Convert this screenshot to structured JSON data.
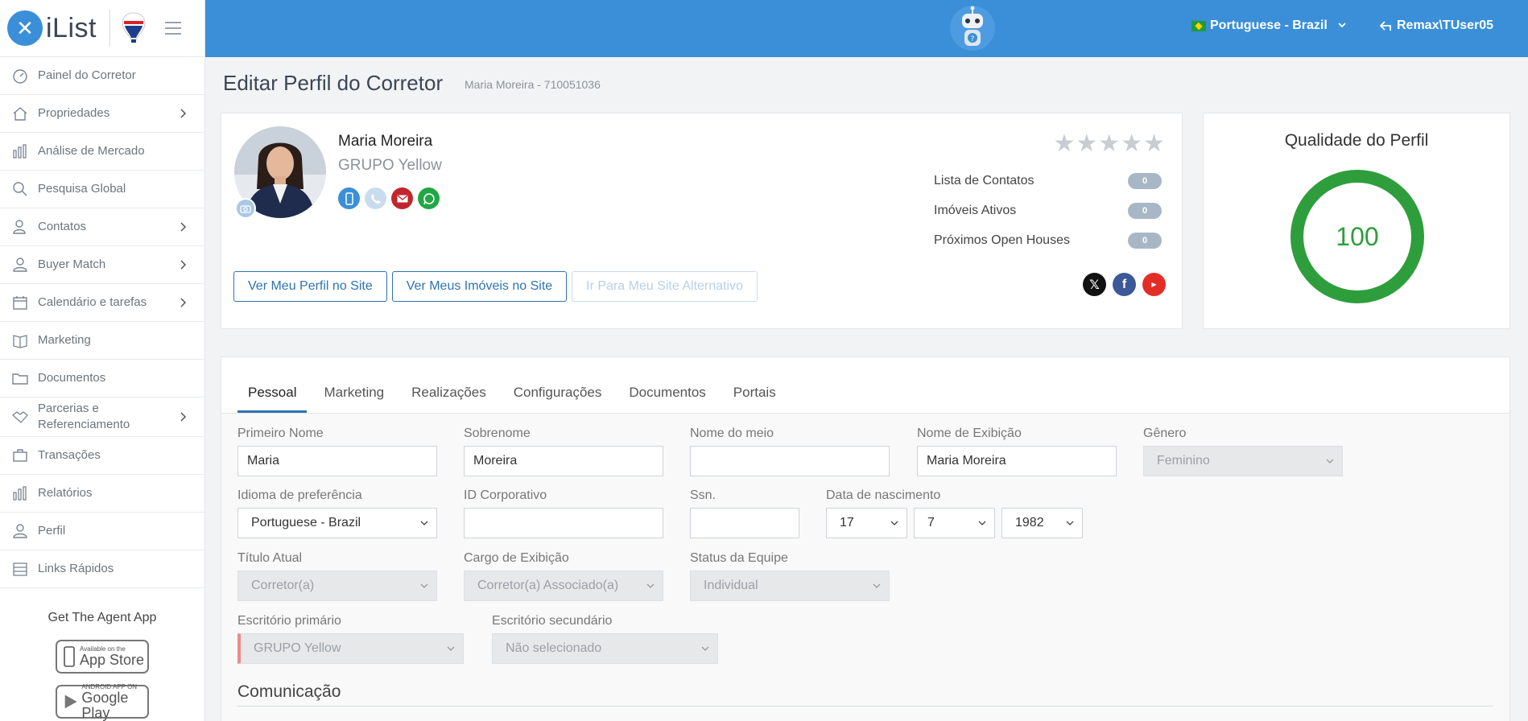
{
  "app": {
    "logo_text": "iList",
    "language": "Portuguese - Brazil",
    "user": "Remax\\TUser05"
  },
  "sidebar": {
    "items": [
      {
        "label": "Painel do Corretor",
        "icon": "dashboard-icon",
        "has_submenu": false
      },
      {
        "label": "Propriedades",
        "icon": "home-icon",
        "has_submenu": true
      },
      {
        "label": "Análise de Mercado",
        "icon": "bar-chart-icon",
        "has_submenu": false
      },
      {
        "label": "Pesquisa Global",
        "icon": "search-icon",
        "has_submenu": false
      },
      {
        "label": "Contatos",
        "icon": "contacts-icon",
        "has_submenu": true
      },
      {
        "label": "Buyer Match",
        "icon": "user-icon",
        "has_submenu": true
      },
      {
        "label": "Calendário e tarefas",
        "icon": "calendar-icon",
        "has_submenu": true
      },
      {
        "label": "Marketing",
        "icon": "book-icon",
        "has_submenu": false
      },
      {
        "label": "Documentos",
        "icon": "folder-icon",
        "has_submenu": false
      },
      {
        "label": "Parcerias e Referenciamento",
        "icon": "handshake-icon",
        "has_submenu": true
      },
      {
        "label": "Transações",
        "icon": "briefcase-icon",
        "has_submenu": false
      },
      {
        "label": "Relatórios",
        "icon": "report-icon",
        "has_submenu": false
      },
      {
        "label": "Perfil",
        "icon": "profile-icon",
        "has_submenu": false
      },
      {
        "label": "Links Rápidos",
        "icon": "links-icon",
        "has_submenu": false
      }
    ],
    "app_title": "Get The Agent App",
    "app_store": {
      "small": "Available on the",
      "big": "App Store"
    },
    "google_play": {
      "small": "ANDROID APP ON",
      "big": "Google Play"
    }
  },
  "page": {
    "title": "Editar Perfil do Corretor",
    "subtitle": "Maria Moreira - 710051036"
  },
  "profile": {
    "name": "Maria Moreira",
    "group": "GRUPO Yellow",
    "rating": 0,
    "stats": [
      {
        "label": "Lista de Contatos",
        "value": "0"
      },
      {
        "label": "Imóveis Ativos",
        "value": "0"
      },
      {
        "label": "Próximos Open Houses",
        "value": "0"
      }
    ],
    "buttons": {
      "view_profile": "Ver Meu Perfil no Site",
      "view_listings": "Ver Meus Imóveis no Site",
      "alt_site": "Ir Para Meu Site Alternativo"
    }
  },
  "quality": {
    "title": "Qualidade do Perfil",
    "score": "100",
    "percent": 100,
    "color": "#2e9e3c"
  },
  "tabs": [
    "Pessoal",
    "Marketing",
    "Realizações",
    "Configurações",
    "Documentos",
    "Portais"
  ],
  "form": {
    "first_name": {
      "label": "Primeiro Nome",
      "value": "Maria"
    },
    "last_name": {
      "label": "Sobrenome",
      "value": "Moreira"
    },
    "middle_name": {
      "label": "Nome do meio",
      "value": ""
    },
    "display_name": {
      "label": "Nome de Exibição",
      "value": "Maria Moreira"
    },
    "gender": {
      "label": "Gênero",
      "value": "Feminino"
    },
    "language": {
      "label": "Idioma de preferência",
      "value": "Portuguese - Brazil"
    },
    "corp_id": {
      "label": "ID Corporativo",
      "value": ""
    },
    "ssn": {
      "label": "Ssn.",
      "value": ""
    },
    "birth": {
      "label": "Data de nascimento",
      "day": "17",
      "month": "7",
      "year": "1982"
    },
    "current_title": {
      "label": "Título Atual",
      "value": "Corretor(a)"
    },
    "display_role": {
      "label": "Cargo de Exibição",
      "value": "Corretor(a) Associado(a)"
    },
    "team_status": {
      "label": "Status da Equipe",
      "value": "Individual"
    },
    "primary_office": {
      "label": "Escritório primário",
      "value": "GRUPO Yellow"
    },
    "secondary_office": {
      "label": "Escritório secundário",
      "value": "Não selecionado"
    },
    "section_title": "Comunicação"
  },
  "colors": {
    "brand": "#3a8fd8",
    "accent": "#2d74b3",
    "success": "#2e9e3c"
  }
}
